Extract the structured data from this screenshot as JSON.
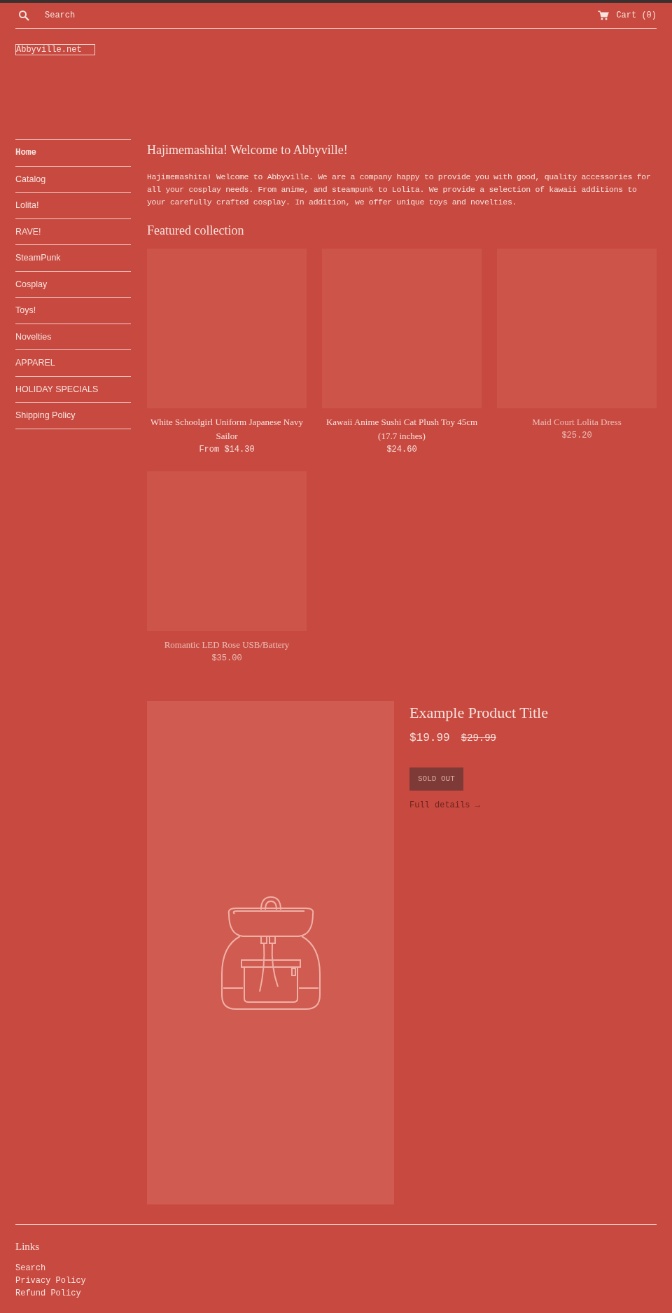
{
  "header": {
    "search_placeholder": "Search",
    "cart": "Cart (0)"
  },
  "logo": "Abbyville.net",
  "sidebar": {
    "items": [
      {
        "label": "Home",
        "selected": true
      },
      {
        "label": "Catalog",
        "selected": false
      },
      {
        "label": "Lolita!",
        "selected": false
      },
      {
        "label": "RAVE!",
        "selected": false
      },
      {
        "label": "SteamPunk",
        "selected": false
      },
      {
        "label": "Cosplay",
        "selected": false
      },
      {
        "label": "Toys!",
        "selected": false
      },
      {
        "label": "Novelties",
        "selected": false
      },
      {
        "label": "APPAREL",
        "selected": false
      },
      {
        "label": "HOLIDAY SPECIALS",
        "selected": false
      },
      {
        "label": "Shipping Policy",
        "selected": false
      }
    ]
  },
  "welcome": {
    "title": "Hajimemashita! Welcome to Abbyville!",
    "text": "Hajimemashita! Welcome to Abbyville. We are a company happy to provide you with good, quality accessories for all your cosplay needs. From anime, and steampunk to Lolita. We provide a selection of kawaii additions to your carefully crafted cosplay. In addition, we offer unique toys and novelties."
  },
  "featured": {
    "title": "Featured collection",
    "products": [
      {
        "title": "White Schoolgirl Uniform Japanese Navy Sailor",
        "price": "From $14.30",
        "dimmed": false
      },
      {
        "title": "Kawaii Anime Sushi Cat Plush Toy 45cm (17.7 inches)",
        "price": "$24.60",
        "dimmed": false
      },
      {
        "title": "Maid Court Lolita Dress",
        "price": "$25.20",
        "dimmed": true
      },
      {
        "title": "Romantic LED Rose USB/Battery",
        "price": "$35.00",
        "dimmed": true
      }
    ]
  },
  "product": {
    "title": "Example Product Title",
    "price": "$19.99",
    "compare_price": "$29.99",
    "button": "SOLD OUT",
    "button_disabled": true,
    "details_link": "Full details →"
  },
  "footer": {
    "title": "Links",
    "links": [
      "Search",
      "Privacy Policy",
      "Refund Policy"
    ]
  }
}
